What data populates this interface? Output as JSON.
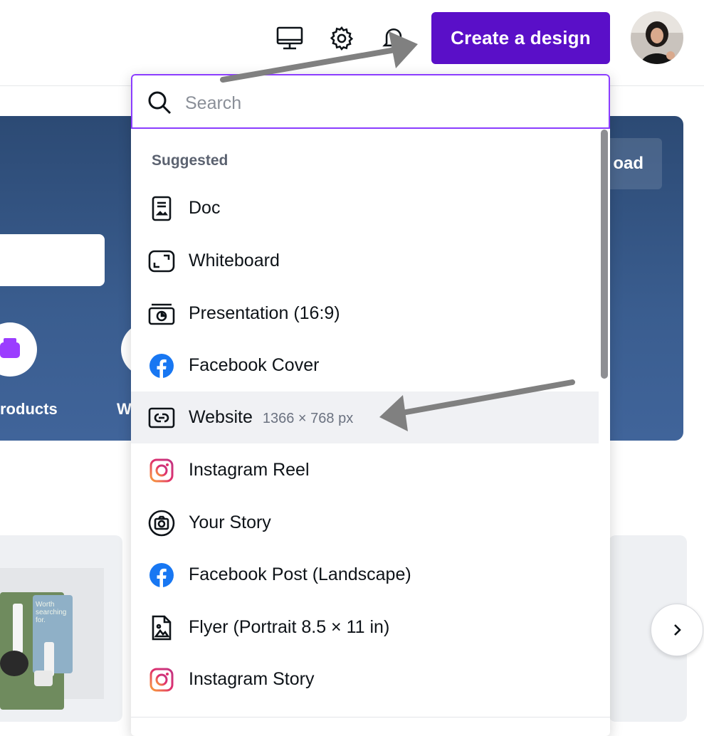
{
  "topbar": {
    "icons": [
      "desktop-icon",
      "gear-icon",
      "bell-icon"
    ],
    "create_button_label": "Create a design"
  },
  "hero": {
    "upload_label": "oad",
    "category_labels": [
      "roducts",
      "W"
    ]
  },
  "dropdown": {
    "search_placeholder": "Search",
    "section_label": "Suggested",
    "items": [
      {
        "label": "Doc",
        "icon": "doc-icon",
        "sub": ""
      },
      {
        "label": "Whiteboard",
        "icon": "whiteboard-icon",
        "sub": ""
      },
      {
        "label": "Presentation (16:9)",
        "icon": "presentation-icon",
        "sub": ""
      },
      {
        "label": "Facebook Cover",
        "icon": "facebook-icon",
        "sub": ""
      },
      {
        "label": "Website",
        "icon": "website-icon",
        "sub": "1366 × 768 px"
      },
      {
        "label": "Instagram Reel",
        "icon": "instagram-icon",
        "sub": ""
      },
      {
        "label": "Your Story",
        "icon": "camera-icon",
        "sub": ""
      },
      {
        "label": "Facebook Post (Landscape)",
        "icon": "facebook-icon",
        "sub": ""
      },
      {
        "label": "Flyer (Portrait 8.5 × 11 in)",
        "icon": "flyer-icon",
        "sub": ""
      },
      {
        "label": "Instagram Story",
        "icon": "instagram-icon",
        "sub": ""
      }
    ],
    "active_index": 4
  },
  "thumbnail_text": "Worth searching for.",
  "colors": {
    "brand_purple": "#5a0fc8",
    "search_focus": "#8b3dff",
    "hero_blue": "#2c4a74",
    "facebook_blue": "#1877f2"
  }
}
